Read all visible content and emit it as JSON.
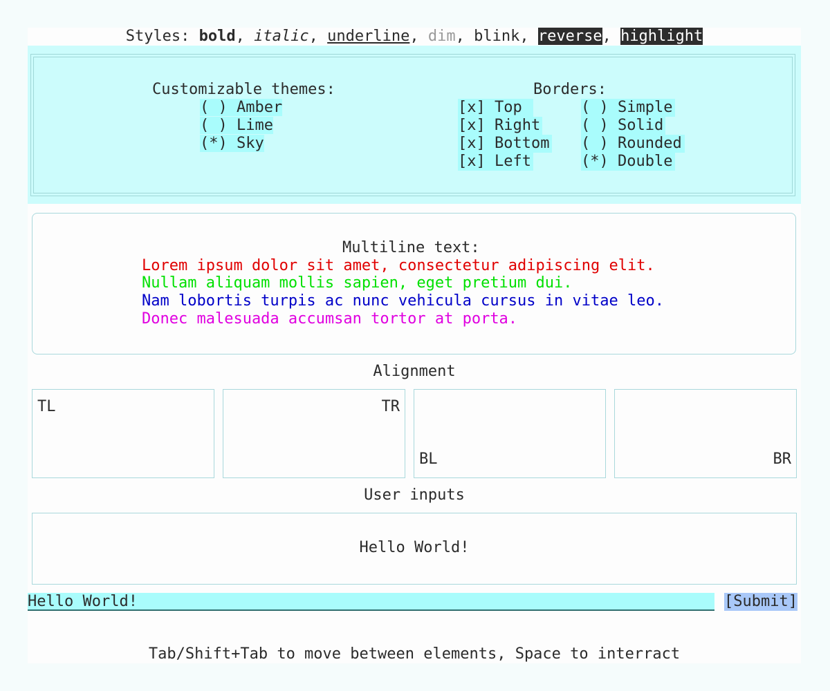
{
  "styles": {
    "prefix": "Styles: ",
    "bold": "bold",
    "italic": "italic",
    "underline": "underline",
    "dim": "dim",
    "blink": "blink",
    "reverse": "reverse",
    "highlight": "highlight",
    "sep": ", "
  },
  "themes": {
    "title": "Customizable themes:",
    "options": [
      {
        "mark": "( )",
        "label": "Amber"
      },
      {
        "mark": "( )",
        "label": "Lime"
      },
      {
        "mark": "(*)",
        "label": "Sky"
      }
    ]
  },
  "borders": {
    "title": "Borders:",
    "sides": [
      {
        "mark": "[x]",
        "label": "Top"
      },
      {
        "mark": "[x]",
        "label": "Right"
      },
      {
        "mark": "[x]",
        "label": "Bottom"
      },
      {
        "mark": "[x]",
        "label": "Left"
      }
    ],
    "types": [
      {
        "mark": "( )",
        "label": "Simple"
      },
      {
        "mark": "( )",
        "label": "Solid"
      },
      {
        "mark": "( )",
        "label": "Rounded"
      },
      {
        "mark": "(*)",
        "label": "Double"
      }
    ]
  },
  "multiline": {
    "title": "Multiline text:",
    "lines": [
      {
        "text": "Lorem ipsum dolor sit amet, consectetur adipiscing elit.",
        "color": "#e00000"
      },
      {
        "text": "Nullam aliquam mollis sapien, eget pretium dui.",
        "color": "#00e000"
      },
      {
        "text": "Nam lobortis turpis ac nunc vehicula cursus in vitae leo.",
        "color": "#0000c8"
      },
      {
        "text": "Donec malesuada accumsan tortor at porta.",
        "color": "#e000e0"
      }
    ]
  },
  "alignment": {
    "title": "Alignment",
    "tl": "TL",
    "tr": "TR",
    "bl": "BL",
    "br": "BR"
  },
  "inputs": {
    "title": "User inputs",
    "display": "Hello World!",
    "value": "Hello World!",
    "submit": "[Submit]"
  },
  "footer": {
    "hint": "Tab/Shift+Tab to move between elements, Space to interract"
  }
}
